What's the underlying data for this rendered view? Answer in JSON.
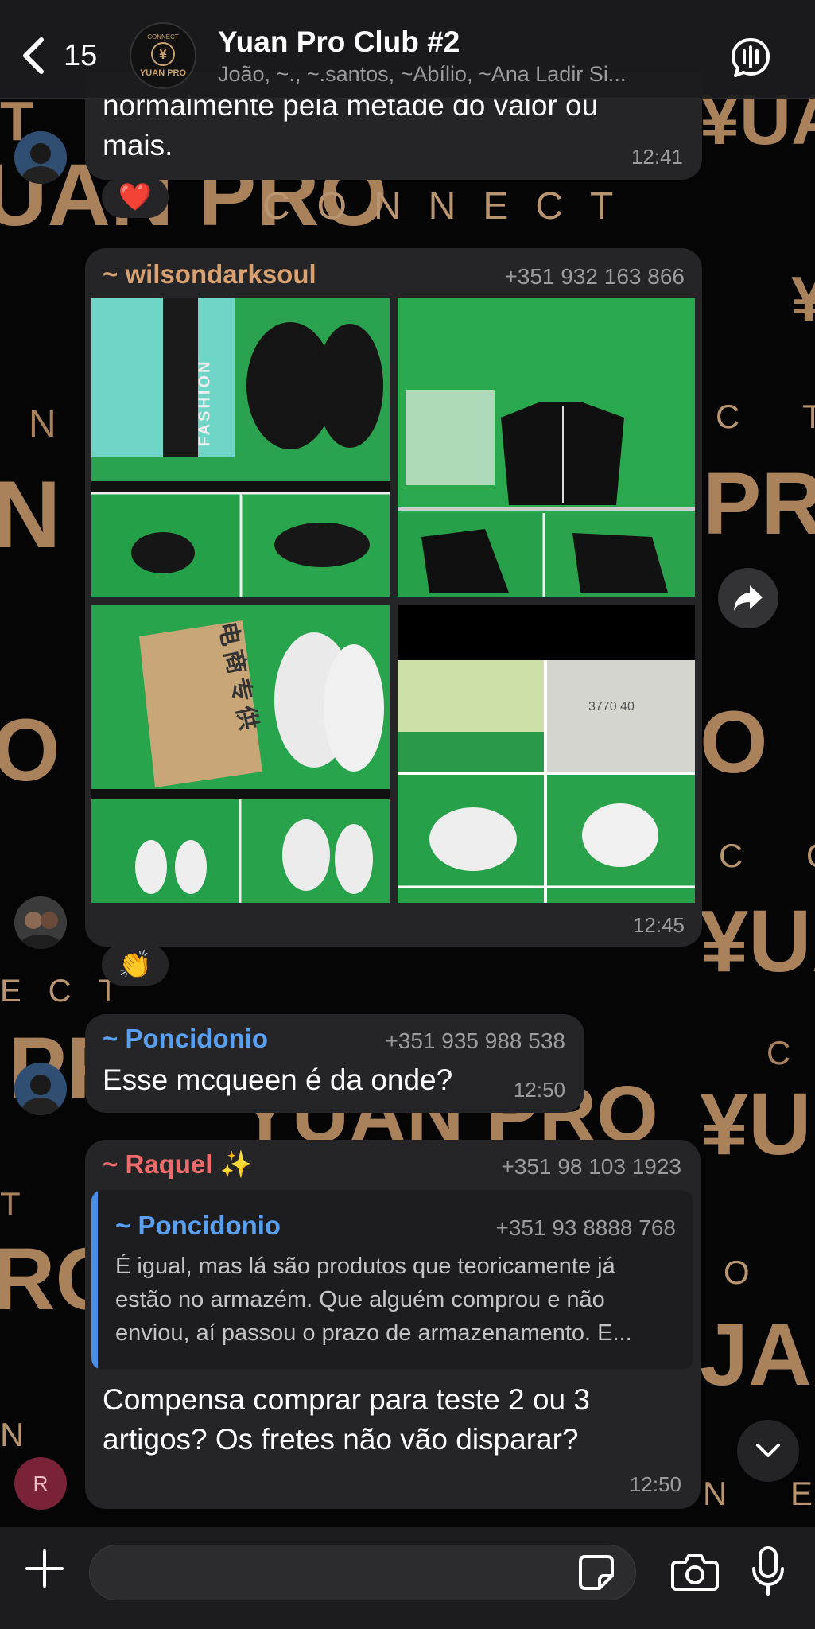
{
  "wallpaper": {
    "connect": "CONNECT",
    "fragments": [
      "N",
      "PRO",
      "O",
      "¥",
      "YUAN PRO",
      "¥UA",
      "ECT",
      "PR",
      "C",
      "¥U",
      "T",
      "RO",
      "O N",
      "JAI",
      "N E",
      "N E C",
      "C T",
      "C O",
      "PRO",
      "¥UA",
      "RC",
      "T",
      "UAN PRO"
    ]
  },
  "header": {
    "back_count": "15",
    "avatar_brand": "YUAN PRO",
    "avatar_top": "CONNECT",
    "title": "Yuan Pro Club #2",
    "subtitle": "João, ~., ~.santos, ~Abílio, ~Ana Ladir Si..."
  },
  "messages": {
    "m1": {
      "text_line1": "normalmente pela metade do valor ou",
      "text_line2": "mais.",
      "time": "12:41",
      "reaction": "❤️"
    },
    "m2": {
      "sender": "~ wilsondarksoul",
      "phone": "+351 932 163 866",
      "time": "12:45",
      "reaction": "👏",
      "photo_texts": {
        "fashion_label": "FASHION",
        "box_label": "电商专供",
        "size_label": "3770 40"
      }
    },
    "m3": {
      "sender": "~ Poncidonio",
      "phone": "+351 935 988 538",
      "text": "Esse mcqueen é da onde?",
      "time": "12:50"
    },
    "m4": {
      "sender": "~ Raquel ✨",
      "phone": "+351 98 103 1923",
      "quote_sender": "~ Poncidonio",
      "quote_phone": "+351 93 8888 768",
      "quote_line1": "É igual, mas lá são produtos que teoricamente já",
      "quote_line2": "estão no armazém. Que alguém comprou e não",
      "quote_line3": "enviou, aí passou o prazo de armazenamento. E...",
      "text_line1": "Compensa comprar para teste 2 ou 3",
      "text_line2": "artigos? Os fretes não vão disparar?",
      "time": "12:50",
      "avatar_letter": "R"
    }
  },
  "colors": {
    "wilson": "#d9a070",
    "poncidonio": "#5aa0f0",
    "raquel": "#ee6b6b",
    "bubble": "#252527",
    "accent_gold": "#a9815a"
  },
  "icons": [
    "back-chevron-icon",
    "call-waveform-icon",
    "forward-icon",
    "chevron-down-icon",
    "plus-icon",
    "sticker-icon",
    "camera-icon",
    "mic-icon"
  ]
}
